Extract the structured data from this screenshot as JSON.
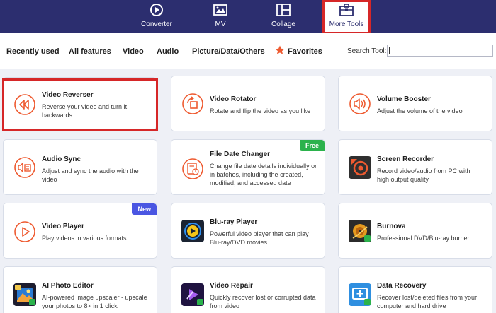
{
  "nav": {
    "items": [
      {
        "label": "Converter",
        "icon": "converter-icon"
      },
      {
        "label": "MV",
        "icon": "mv-icon"
      },
      {
        "label": "Collage",
        "icon": "collage-icon"
      },
      {
        "label": "More Tools",
        "icon": "toolbox-icon",
        "active": true
      }
    ]
  },
  "filters": {
    "recently_used": "Recently used",
    "all_features": "All features",
    "video": "Video",
    "audio": "Audio",
    "picture": "Picture/Data/Others",
    "favorites": "Favorites"
  },
  "search": {
    "label": "Search Tool:",
    "value": ""
  },
  "cards": [
    {
      "title": "Video Reverser",
      "desc": "Reverse your video and turn it backwards",
      "icon": "reverse-icon"
    },
    {
      "title": "Video Rotator",
      "desc": "Rotate and flip the video as you like",
      "icon": "rotate-icon"
    },
    {
      "title": "Volume Booster",
      "desc": "Adjust the volume of the video",
      "icon": "volume-icon"
    },
    {
      "title": "Audio Sync",
      "desc": "Adjust and sync the audio with the video",
      "icon": "audio-sync-icon"
    },
    {
      "title": "File Date Changer",
      "desc": "Change file date details individually or in batches, including the created, modified, and accessed date",
      "icon": "file-date-icon",
      "badge": "Free"
    },
    {
      "title": "Screen Recorder",
      "desc": "Record video/audio from PC with high output quality",
      "icon": "screen-recorder-icon"
    },
    {
      "title": "Video Player",
      "desc": "Play videos in various formats",
      "icon": "play-icon",
      "badge": "New"
    },
    {
      "title": "Blu-ray Player",
      "desc": "Powerful video player that can play Blu-ray/DVD movies",
      "icon": "bluray-player-icon"
    },
    {
      "title": "Burnova",
      "desc": "Professional DVD/Blu-ray burner",
      "icon": "burnova-icon"
    },
    {
      "title": "AI Photo Editor",
      "desc": "AI-powered image upscaler - upscale your photos to  8× in 1 click",
      "icon": "ai-photo-editor-icon"
    },
    {
      "title": "Video Repair",
      "desc": "Quickly recover lost or corrupted data from video",
      "icon": "video-repair-icon"
    },
    {
      "title": "Data Recovery",
      "desc": "Recover lost/deleted files from your computer and hard drive",
      "icon": "data-recovery-icon"
    }
  ],
  "colors": {
    "nav_bg": "#2c2e6f",
    "accent": "#ee5a30",
    "highlight": "#d62728",
    "badge_free": "#2bb24c",
    "badge_new": "#4a56e2",
    "page_bg": "#eef0f6"
  }
}
